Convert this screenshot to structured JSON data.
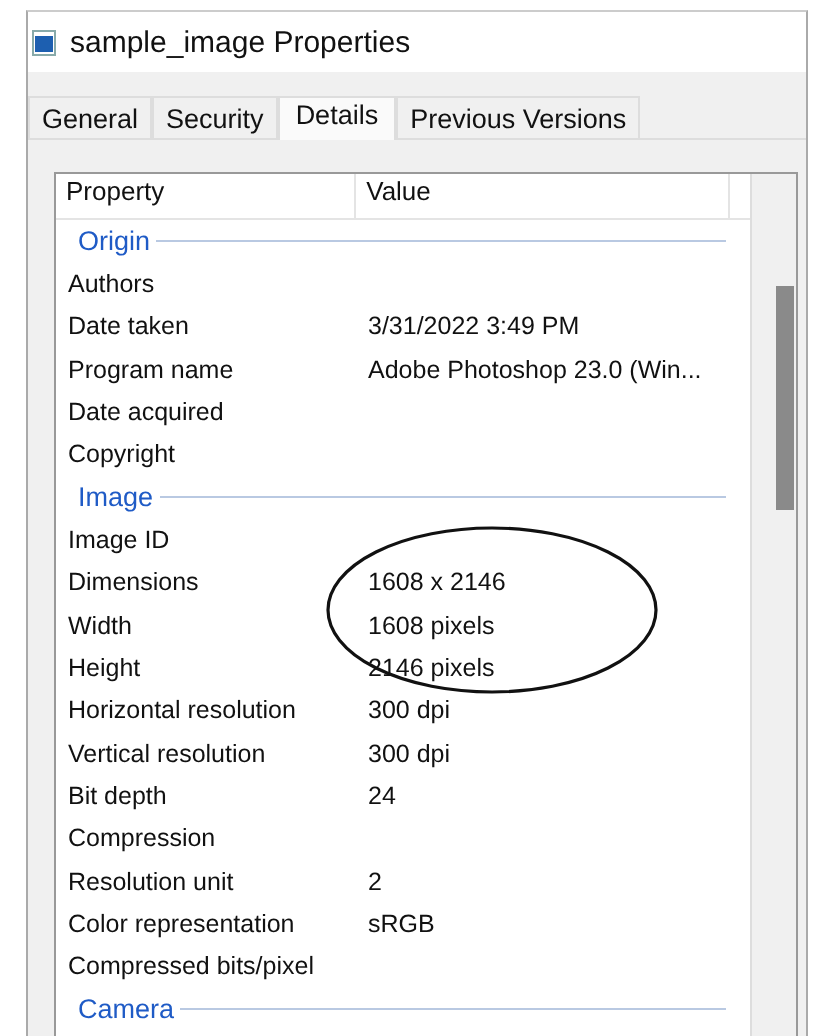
{
  "window": {
    "title": "sample_image Properties"
  },
  "tabs": [
    {
      "label": "General",
      "selected": false
    },
    {
      "label": "Security",
      "selected": false
    },
    {
      "label": "Details",
      "selected": true
    },
    {
      "label": "Previous Versions",
      "selected": false
    }
  ],
  "table": {
    "columns": [
      "Property",
      "Value"
    ],
    "rows": [
      {
        "kind": "section",
        "label": "Origin"
      },
      {
        "kind": "property",
        "label": "Authors"
      },
      {
        "kind": "property",
        "label": "Date taken",
        "value": "3/31/2022 3:49 PM"
      },
      {
        "kind": "property",
        "label": "Program name",
        "value": "Adobe Photoshop 23.0 (Win..."
      },
      {
        "kind": "property",
        "label": "Date acquired"
      },
      {
        "kind": "property",
        "label": "Copyright"
      },
      {
        "kind": "section",
        "label": "Image"
      },
      {
        "kind": "property",
        "label": "Image ID"
      },
      {
        "kind": "property",
        "label": "Dimensions",
        "value": "1608 x 2146"
      },
      {
        "kind": "property",
        "label": "Width",
        "value": "1608 pixels"
      },
      {
        "kind": "property",
        "label": "Height",
        "value": "2146 pixels"
      },
      {
        "kind": "property",
        "label": "Horizontal resolution",
        "value": "300 dpi"
      },
      {
        "kind": "property",
        "label": "Vertical resolution",
        "value": "300 dpi"
      },
      {
        "kind": "property",
        "label": "Bit depth",
        "value": "24"
      },
      {
        "kind": "property",
        "label": "Compression"
      },
      {
        "kind": "property",
        "label": "Resolution unit",
        "value": "2"
      },
      {
        "kind": "property",
        "label": "Color representation",
        "value": "sRGB"
      },
      {
        "kind": "property",
        "label": "Compressed bits/pixel"
      },
      {
        "kind": "section",
        "label": "Camera"
      }
    ]
  }
}
